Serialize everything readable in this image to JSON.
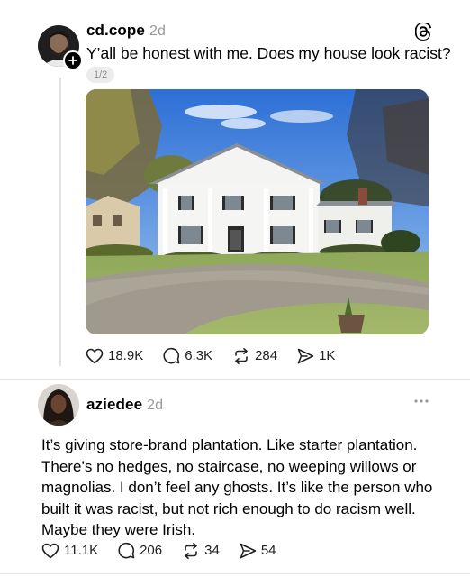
{
  "post1": {
    "username": "cd.cope",
    "time": "2d",
    "text": "Y’all be honest with me. Does my house look racist?",
    "page_indicator": "1/2",
    "stats": {
      "likes": "18.9K",
      "replies": "6.3K",
      "reposts": "284",
      "shares": "1K"
    }
  },
  "post2": {
    "username": "aziedee",
    "time": "2d",
    "lines": [
      "It’s giving store-brand plantation. Like starter plantation.",
      "There’s no hedges, no staircase, no weeping willows or",
      "magnolias. I don’t feel any ghosts. It’s like the person who",
      "built it was racist, but not rich enough to do racism well.",
      "Maybe they were Irish."
    ],
    "stats": {
      "likes": "11.1K",
      "replies": "206",
      "reposts": "34",
      "shares": "54"
    }
  },
  "icons": {
    "threads_logo": "threads-icon",
    "like": "heart-icon",
    "reply": "comment-icon",
    "repost": "repost-icon",
    "share": "share-icon",
    "follow": "plus-icon",
    "more": "more-icon"
  }
}
